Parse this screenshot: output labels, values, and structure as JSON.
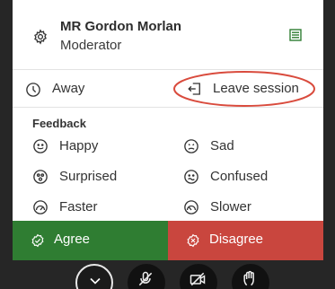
{
  "user": {
    "name": "MR Gordon Morlan",
    "role": "Moderator",
    "gear_icon": "gear-icon",
    "list_icon": "list-icon"
  },
  "status": {
    "away_label": "Away",
    "away_icon": "clock-icon",
    "leave_label": "Leave session",
    "leave_icon": "exit-icon",
    "highlight_color": "#d94b3d"
  },
  "feedback": {
    "title": "Feedback",
    "items": [
      {
        "label": "Happy",
        "icon": "happy-face-icon"
      },
      {
        "label": "Sad",
        "icon": "sad-face-icon"
      },
      {
        "label": "Surprised",
        "icon": "surprised-face-icon"
      },
      {
        "label": "Confused",
        "icon": "confused-face-icon"
      },
      {
        "label": "Faster",
        "icon": "faster-icon"
      },
      {
        "label": "Slower",
        "icon": "slower-icon"
      }
    ]
  },
  "votes": {
    "agree_label": "Agree",
    "disagree_label": "Disagree",
    "agree_color": "#2f7d32",
    "disagree_color": "#c9463e"
  },
  "colors": {
    "panel_bg": "#ffffff",
    "page_bg": "#262626",
    "accent_green": "#2f7d32"
  }
}
